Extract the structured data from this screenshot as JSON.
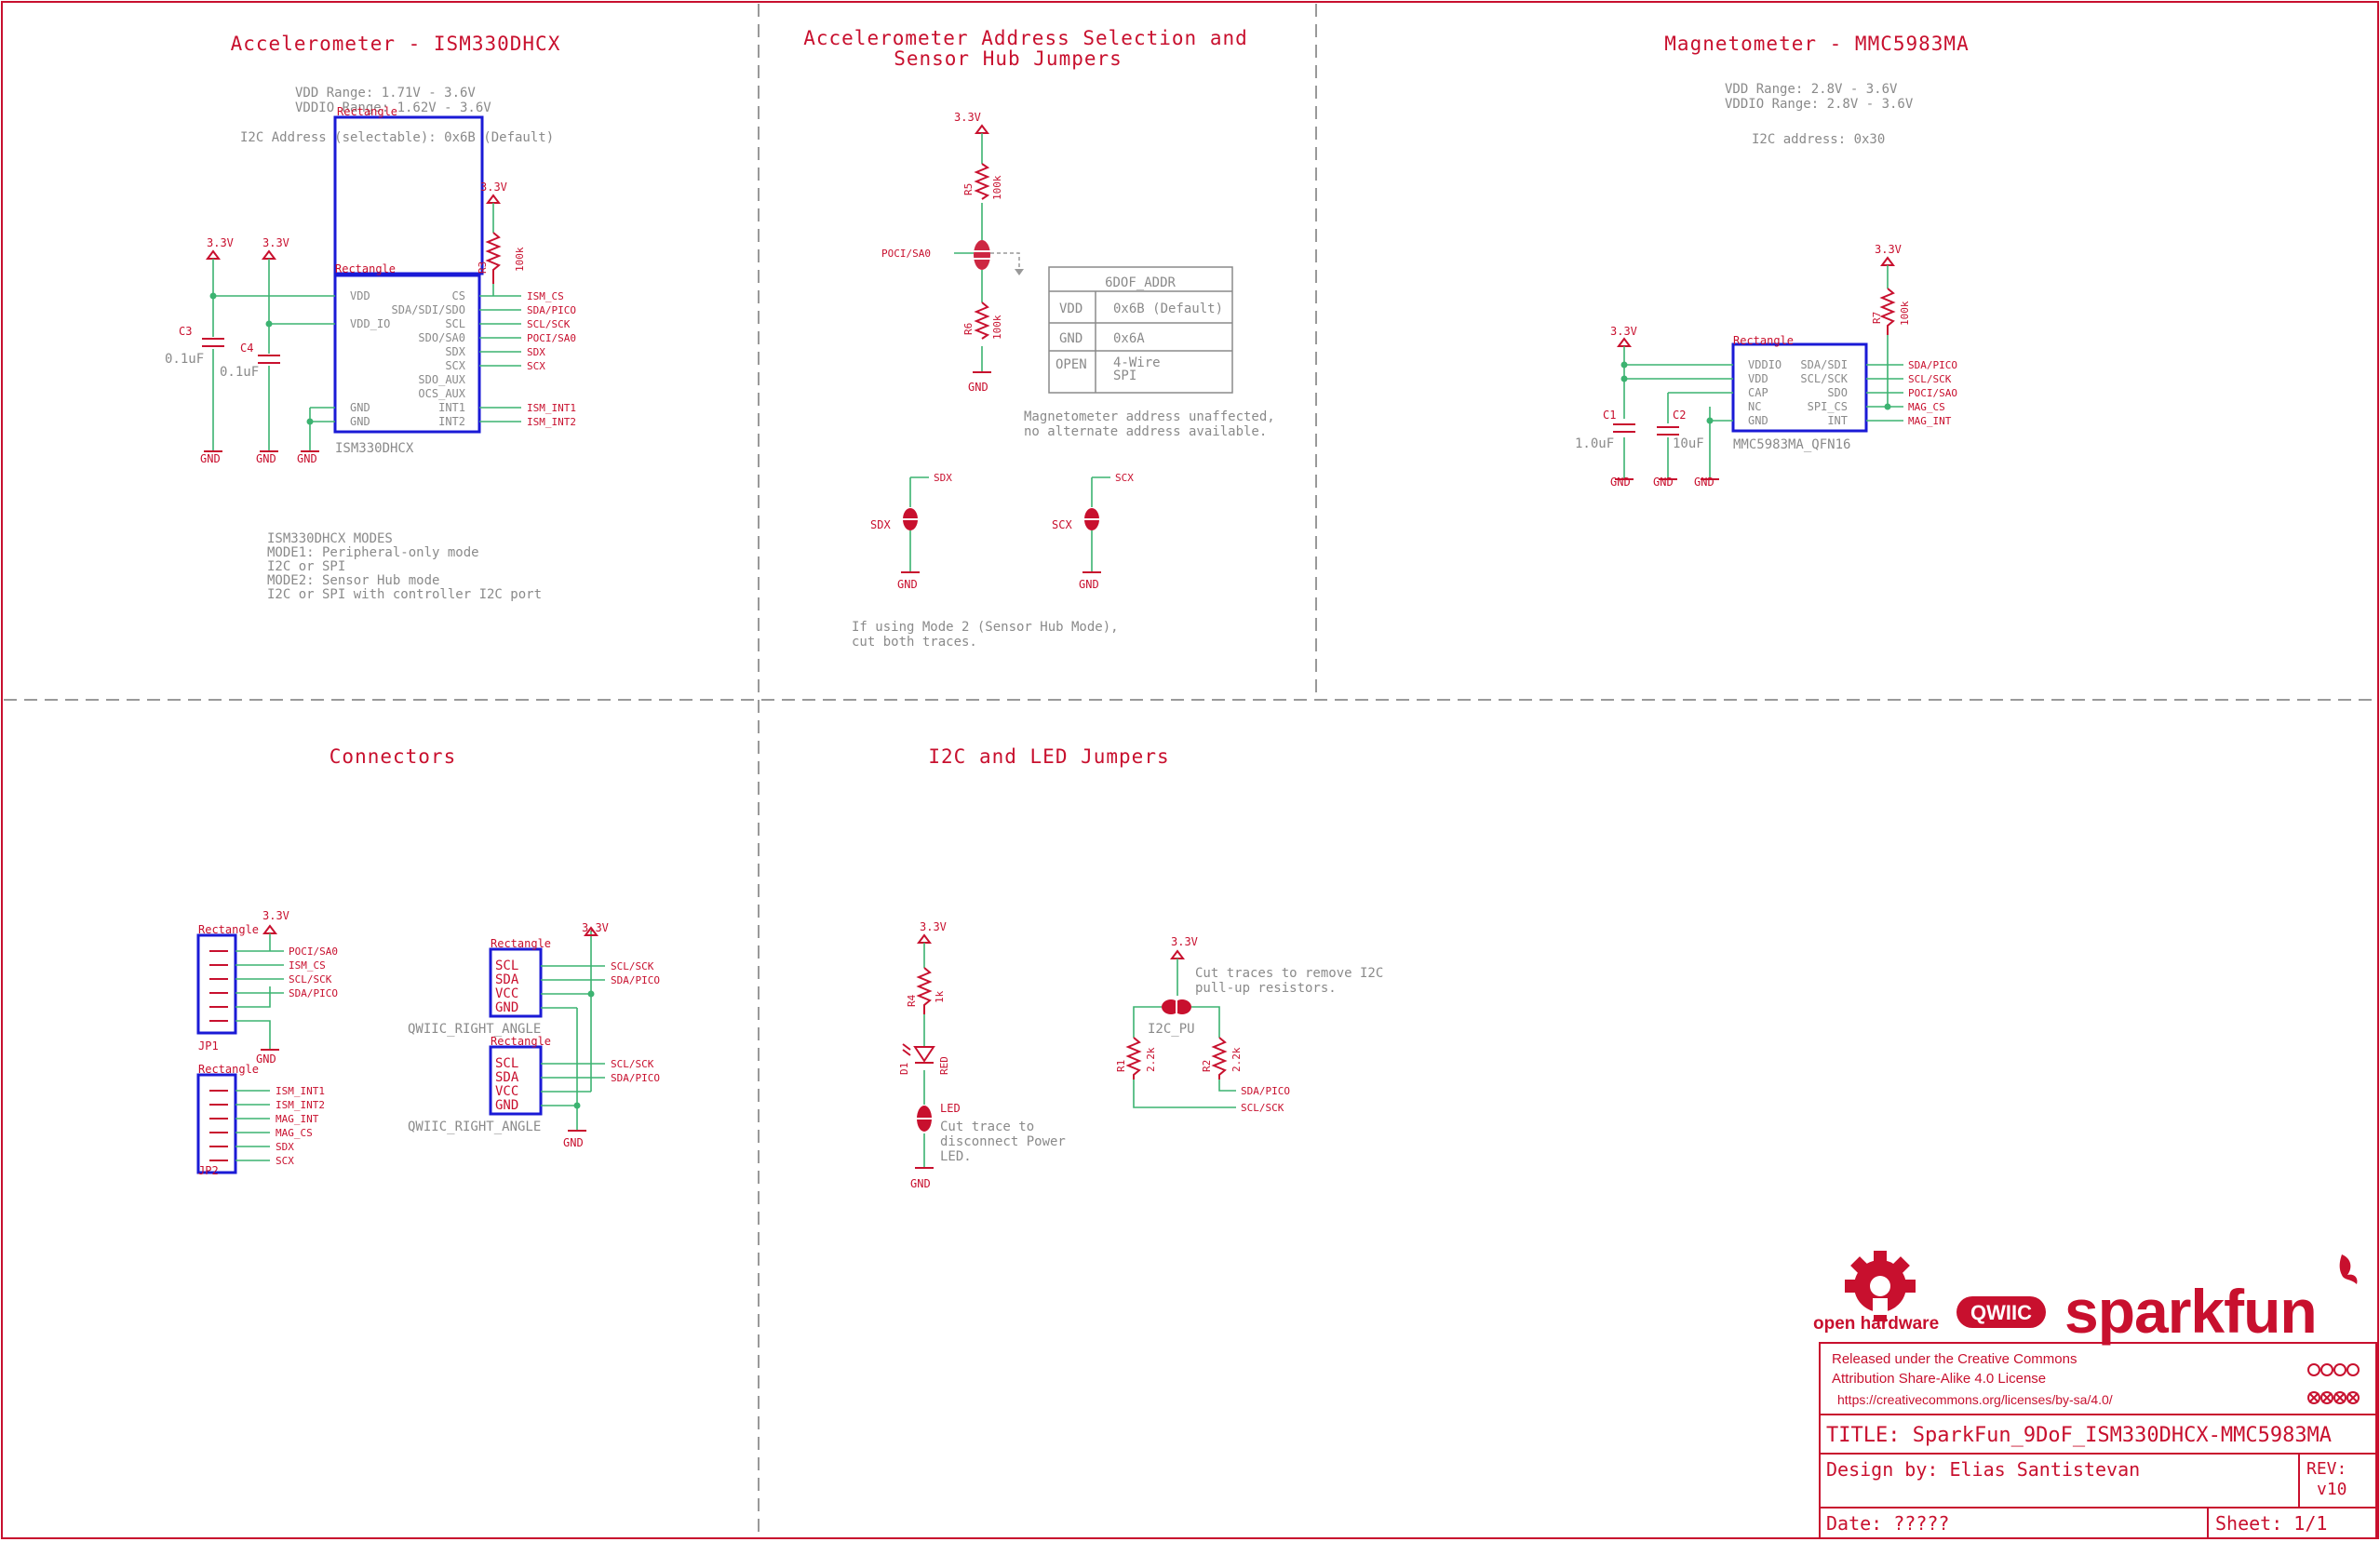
{
  "sections": {
    "accel_title": "Accelerometer - ISM330DHCX",
    "addr_title_1": "Accelerometer Address Selection and",
    "addr_title_2": "Sensor Hub Jumpers",
    "mag_title": "Magnetometer - MMC5983MA",
    "conn_title": "Connectors",
    "i2c_title": "I2C and LED Jumpers"
  },
  "accel": {
    "notes": [
      "VDD Range: 1.71V - 3.6V",
      "VDDIO Range: 1.62V - 3.6V",
      "I2C Address (selectable): 0x6B (Default)"
    ],
    "part_name": "ISM330DHCX",
    "rect_label": "Rectangle",
    "pins_left": [
      "VDD",
      "VDD_IO",
      "GND",
      "GND"
    ],
    "pins_right": [
      "CS",
      "SDA/SDI/SDO",
      "SCL",
      "SDO/SA0",
      "SDX",
      "SCX",
      "SDO_AUX",
      "OCS_AUX",
      "INT1",
      "INT2"
    ],
    "nets_right": [
      "ISM_CS",
      "SDA/PICO",
      "SCL/SCK",
      "POCI/SA0",
      "SDX",
      "SCX",
      "",
      "",
      "ISM_INT1",
      "ISM_INT2"
    ],
    "caps": [
      {
        "name": "C3",
        "value": "0.1uF"
      },
      {
        "name": "C4",
        "value": "0.1uF"
      }
    ],
    "r3": {
      "name": "R3",
      "value": "100k"
    },
    "supply": "3.3V",
    "gnd": "GND",
    "modes": [
      "ISM330DHCX MODES",
      "MODE1:  Peripheral-only mode",
      "   I2C or SPI",
      "MODE2:  Sensor Hub mode",
      "   I2C or SPI with controller I2C port"
    ]
  },
  "addr": {
    "supply": "3.3V",
    "gnd": "GND",
    "r5": {
      "name": "R5",
      "value": "100k"
    },
    "r6": {
      "name": "R6",
      "value": "100k"
    },
    "net": "POCI/SA0",
    "table_title": "6DOF_ADDR",
    "table_rows": [
      [
        "VDD",
        "0x6B (Default)"
      ],
      [
        "GND",
        "0x6A"
      ],
      [
        "OPEN",
        "4-Wire\nSPI"
      ]
    ],
    "note": [
      "Magnetometer address unaffected,",
      "no alternate address available."
    ],
    "jumper_sdx": "SDX",
    "jumper_scx": "SCX",
    "mode_note": [
      "If using Mode 2 (Sensor Hub Mode),",
      "cut both traces."
    ]
  },
  "mag": {
    "notes": [
      "VDD Range: 2.8V - 3.6V",
      "VDDIO Range: 2.8V - 3.6V",
      "I2C address: 0x30"
    ],
    "part_name": "MMC5983MA_QFN16",
    "rect_label": "Rectangle",
    "pins_left": [
      "VDDIO",
      "VDD",
      "CAP",
      "NC",
      "GND"
    ],
    "pins_right": [
      "SDA/SDI",
      "SCL/SCK",
      "SDO",
      "SPI_CS",
      "INT"
    ],
    "nets_right": [
      "SDA/PICO",
      "SCL/SCK",
      "POCI/SAO",
      "MAG_CS",
      "MAG_INT"
    ],
    "caps": [
      {
        "name": "C1",
        "value": "1.0uF"
      },
      {
        "name": "C2",
        "value": "10uF"
      }
    ],
    "r7": {
      "name": "R7",
      "value": "100k"
    },
    "supply": "3.3V",
    "gnd": "GND"
  },
  "conn": {
    "rect_label": "Rectangle",
    "jp1": "JP1",
    "jp2": "JP2",
    "jp1_nets": [
      "POCI/SA0",
      "ISM_CS",
      "SCL/SCK",
      "SDA/PICO",
      "",
      ""
    ],
    "jp2_nets": [
      "ISM_INT1",
      "ISM_INT2",
      "MAG_INT",
      "MAG_CS",
      "SDX",
      "SCX"
    ],
    "qwiic_pins": [
      "SCL",
      "SDA",
      "VCC",
      "GND"
    ],
    "qwiic_nets": [
      "SCL/SCK",
      "SDA/PICO"
    ],
    "qwiic_name": "QWIIC_RIGHT_ANGLE",
    "supply": "3.3V",
    "gnd": "GND"
  },
  "i2c": {
    "supply": "3.3V",
    "r4": {
      "name": "R4",
      "value": "1k"
    },
    "d1": {
      "name": "D1",
      "value": "RED"
    },
    "led_jumper": "LED",
    "led_note": [
      "Cut trace to",
      "disconnect Power",
      "LED."
    ],
    "gnd": "GND",
    "pu_note": [
      "Cut traces to remove I2C",
      "pull-up resistors."
    ],
    "pu_jumper": "I2C_PU",
    "r1": {
      "name": "R1",
      "value": "2.2k"
    },
    "r2": {
      "name": "R2",
      "value": "2.2k"
    },
    "nets": [
      "SDA/PICO",
      "SCL/SCK"
    ]
  },
  "title_block": {
    "logo_oh": "open hardware",
    "logo_qwiic": "QWIIC",
    "logo_sf": "sparkfun",
    "license": [
      "Released under the Creative Commons",
      "Attribution Share-Alike 4.0 License",
      "https://creativecommons.org/licenses/by-sa/4.0/"
    ],
    "title": "TITLE: SparkFun_9DoF_ISM330DHCX-MMC5983MA",
    "design_by": "Design by:  Elias Santistevan",
    "rev_label": "REV:",
    "rev": "v10",
    "date": "Date: ?????",
    "sheet": "Sheet: 1/1"
  },
  "colors": {
    "frame": "#c8102e",
    "wire": "#3cb371",
    "outline": "#1a1ad6",
    "text": "#8a8a8a"
  }
}
